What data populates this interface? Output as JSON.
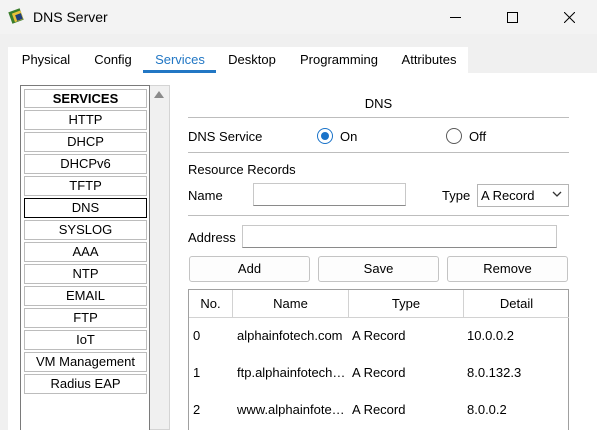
{
  "window": {
    "title": "DNS Server",
    "icon": "router-device-icon"
  },
  "tabs": [
    {
      "label": "Physical",
      "active": false
    },
    {
      "label": "Config",
      "active": false
    },
    {
      "label": "Services",
      "active": true
    },
    {
      "label": "Desktop",
      "active": false
    },
    {
      "label": "Programming",
      "active": false
    },
    {
      "label": "Attributes",
      "active": false
    }
  ],
  "services": {
    "header": "SERVICES",
    "selected": "DNS",
    "items": [
      "HTTP",
      "DHCP",
      "DHCPv6",
      "TFTP",
      "DNS",
      "SYSLOG",
      "AAA",
      "NTP",
      "EMAIL",
      "FTP",
      "IoT",
      "VM Management",
      "Radius EAP"
    ]
  },
  "dns": {
    "title": "DNS",
    "service_label": "DNS Service",
    "on_label": "On",
    "off_label": "Off",
    "service_state": "On",
    "resource_records_label": "Resource Records",
    "name_label": "Name",
    "name_value": "",
    "type_label": "Type",
    "type_value": "A Record",
    "address_label": "Address",
    "address_value": "",
    "add_label": "Add",
    "save_label": "Save",
    "remove_label": "Remove"
  },
  "records_table": {
    "columns": [
      "No.",
      "Name",
      "Type",
      "Detail"
    ],
    "rows": [
      {
        "no": "0",
        "name": "alphainfotech.com",
        "type": "A Record",
        "detail": "10.0.0.2"
      },
      {
        "no": "1",
        "name": "ftp.alphainfotech…",
        "type": "A Record",
        "detail": "8.0.132.3"
      },
      {
        "no": "2",
        "name": "www.alphainfote…",
        "type": "A Record",
        "detail": "8.0.0.2"
      }
    ]
  },
  "colors": {
    "accent": "#2277c4",
    "radio_checked": "#1a73c9"
  }
}
